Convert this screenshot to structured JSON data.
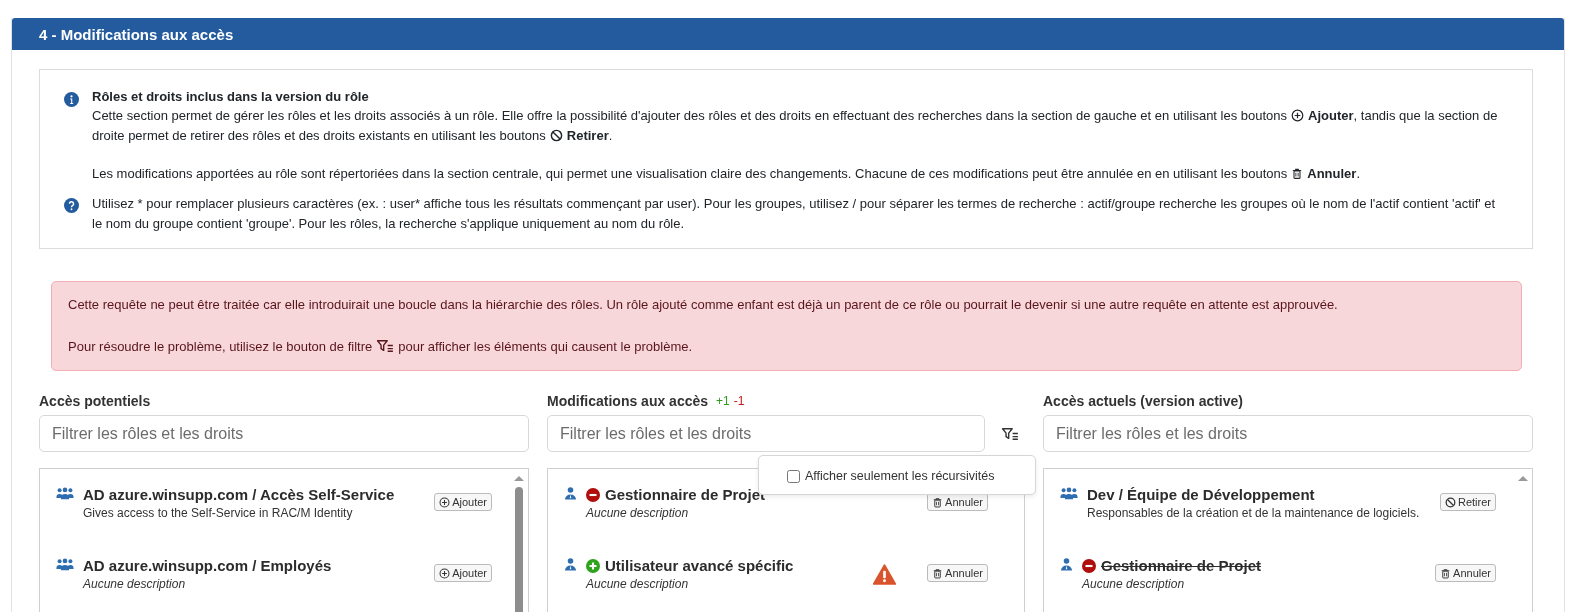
{
  "section_title": "4 - Modifications aux accès",
  "info_blocks": [
    {
      "kind": "info",
      "title": "Rôles et droits inclus dans la version du rôle",
      "paragraphs": [
        [
          {
            "text": "Cette section permet de gérer les rôles et les droits associés à un rôle. Elle offre la possibilité d'ajouter des rôles et des droits en effectuant des recherches dans la section de gauche et en utilisant les boutons"
          },
          {
            "kind": "add"
          },
          {
            "text": "**Ajouter**, tandis que la section de droite permet de retirer des rôles et des droits existants en utilisant les boutons"
          },
          {
            "kind": "remove"
          },
          {
            "text": "**Retirer**."
          }
        ],
        [
          {
            "text": "Les modifications apportées au rôle sont répertoriées dans la section centrale, qui permet une visualisation claire des changements. Chacune de ces modifications peut être annulée en en utilisant les boutons"
          },
          {
            "kind": "cancel"
          },
          {
            "text": "**Annuler**."
          }
        ]
      ]
    },
    {
      "kind": "help",
      "paragraphs": [
        [
          {
            "text": "Utilisez * pour remplacer plusieurs caractères (ex. : user* affiche tous les résultats commençant par user). Pour les groupes, utilisez / pour séparer les termes de recherche : actif/groupe recherche les groupes où le nom de l'actif contient 'actif' et le nom du groupe contient 'groupe'. Pour les rôles, la recherche s'applique uniquement au nom du rôle."
          }
        ]
      ]
    }
  ],
  "alert": {
    "paragraphs": [
      [
        {
          "text": "Cette requête ne peut être traitée car elle introduirait une boucle dans la hiérarchie des rôles. Un rôle ajouté comme enfant est déjà un parent de ce rôle ou pourrait le devenir si une autre requête en attente est approuvée."
        }
      ],
      [
        {
          "text": "Pour résoudre le problème, utilisez le bouton de filtre"
        },
        {
          "kind": "filter"
        },
        {
          "text": "pour afficher les éléments qui causent le problème."
        }
      ]
    ]
  },
  "columns": [
    {
      "kind": "potential",
      "title": "Accès potentiels",
      "search": {
        "placeholder": "Filtrer les rôles et les droits"
      },
      "items": [
        {
          "kind": "group",
          "added": false,
          "removed": false,
          "title": "AD azure.winsupp.com / Accès Self-Service",
          "description": "Gives access to the Self-Service in RAC/M Identity",
          "description_missing": false,
          "struck": false,
          "warning": false,
          "action": {
            "kind": "add",
            "label": "Ajouter"
          }
        },
        {
          "kind": "group",
          "added": false,
          "removed": false,
          "title": "AD azure.winsupp.com / Employés",
          "description": "Aucune description",
          "description_missing": true,
          "struck": false,
          "warning": false,
          "action": {
            "kind": "add",
            "label": "Ajouter"
          }
        }
      ]
    },
    {
      "kind": "changes",
      "title": "Modifications aux accès",
      "counts": {
        "added": "+1",
        "removed": "-1"
      },
      "search": {
        "placeholder": "Filtrer les rôles et les droits"
      },
      "filter_menu": {
        "open": true,
        "option": {
          "label": "Afficher seulement les récursivités",
          "checked": false
        }
      },
      "items": [
        {
          "kind": "user",
          "added": false,
          "removed": true,
          "title": "Gestionnaire de Projet",
          "description": "Aucune description",
          "description_missing": true,
          "struck": false,
          "warning": false,
          "action": {
            "kind": "cancel",
            "label": "Annuler"
          }
        },
        {
          "kind": "user",
          "added": true,
          "removed": false,
          "title": "Utilisateur avancé spécific",
          "description": "Aucune description",
          "description_missing": true,
          "struck": false,
          "warning": true,
          "action": {
            "kind": "cancel",
            "label": "Annuler"
          }
        }
      ]
    },
    {
      "kind": "current",
      "title": "Accès actuels (version active)",
      "search": {
        "placeholder": "Filtrer les rôles et les droits"
      },
      "items": [
        {
          "kind": "group",
          "added": false,
          "removed": false,
          "title": "Dev / Équipe de Développement",
          "description": "Responsables de la création et de la maintenance de logiciels.",
          "description_missing": false,
          "struck": false,
          "warning": false,
          "action": {
            "kind": "remove",
            "label": "Retirer"
          }
        },
        {
          "kind": "user",
          "added": false,
          "removed": true,
          "title": "Gestionnaire de Projet",
          "description": "Aucune description",
          "description_missing": true,
          "struck": true,
          "warning": false,
          "action": {
            "kind": "cancel",
            "label": "Annuler"
          }
        }
      ]
    }
  ]
}
